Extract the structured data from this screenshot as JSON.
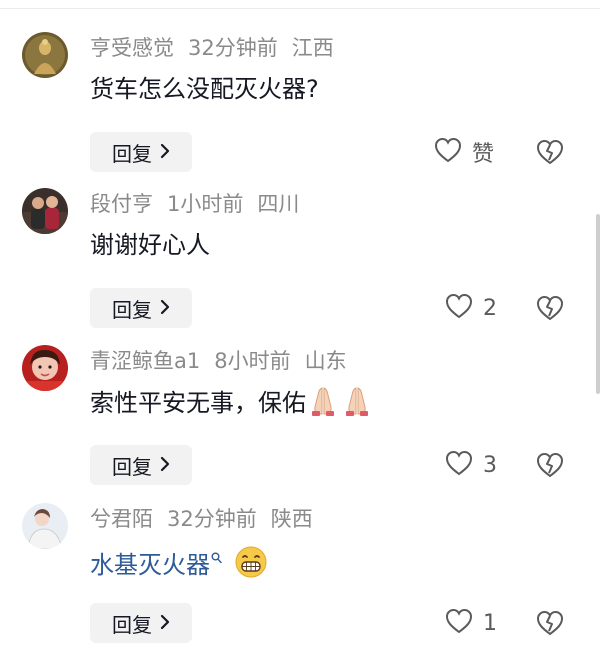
{
  "comments": [
    {
      "username": "亨受感觉",
      "time": "32分钟前",
      "location": "江西",
      "text": "货车怎么没配灭火器?",
      "reply_label": "回复",
      "like_text": "赞"
    },
    {
      "username": "段付亨",
      "time": "1小时前",
      "location": "四川",
      "text": "谢谢好心人",
      "reply_label": "回复",
      "like_text": "2"
    },
    {
      "username": "青涩鲸鱼a1",
      "time": "8小时前",
      "location": "山东",
      "text": "索性平安无事，保佑",
      "emoji": [
        "folded-hands",
        "folded-hands"
      ],
      "reply_label": "回复",
      "like_text": "3"
    },
    {
      "username": "兮君陌",
      "time": "32分钟前",
      "location": "陕西",
      "link_text": "水基灭火器",
      "emoji": [
        "grinning-face"
      ],
      "reply_label": "回复",
      "like_text": "1"
    }
  ],
  "icons": {
    "like": "heart-outline-icon",
    "dislike": "broken-heart-icon",
    "reply_arrow": "chevron-right-icon",
    "search": "search-icon"
  },
  "colors": {
    "text": "#161823",
    "meta": "#8a8a8a",
    "link": "#2d5a98",
    "reply_bg": "#f2f2f2"
  }
}
